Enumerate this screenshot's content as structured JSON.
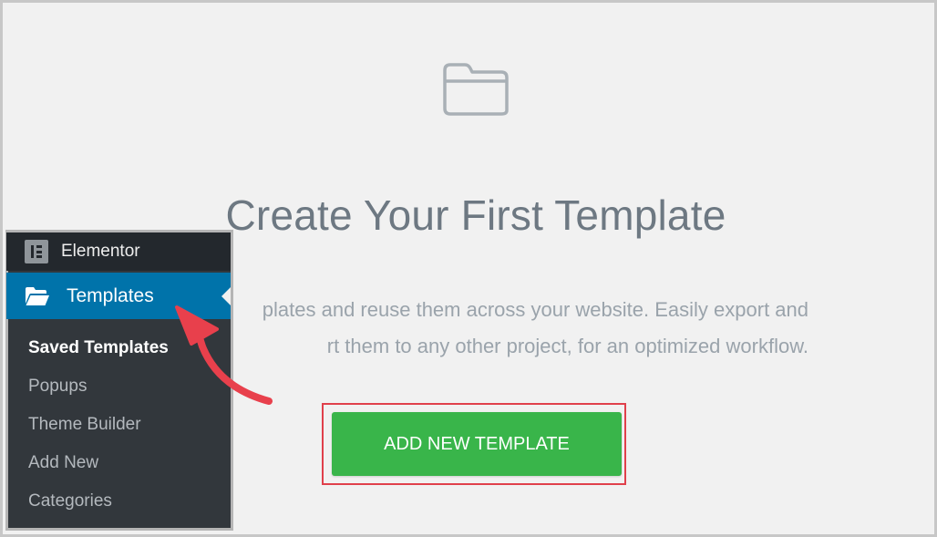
{
  "main": {
    "title": "Create Your First Template",
    "description_line_1": "plates and reuse them across your website. Easily export and",
    "description_line_2": "rt them to any other project, for an optimized workflow.",
    "cta_label": "ADD NEW TEMPLATE",
    "icon": "folder-outline-icon"
  },
  "sidebar": {
    "top_item": {
      "label": "Elementor",
      "icon": "elementor-icon"
    },
    "active_item": {
      "label": "Templates",
      "icon": "folder-open-icon"
    },
    "submenu": [
      {
        "label": "Saved Templates",
        "current": true
      },
      {
        "label": "Popups"
      },
      {
        "label": "Theme Builder"
      },
      {
        "label": "Add New"
      },
      {
        "label": "Categories"
      }
    ]
  },
  "colors": {
    "accent_green": "#39b54a",
    "highlight_red": "#e0404b",
    "wp_blue": "#0073aa",
    "wp_dark": "#32373c"
  }
}
